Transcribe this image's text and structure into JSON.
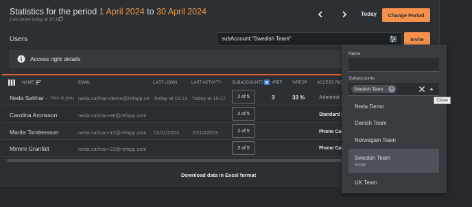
{
  "header": {
    "title_prefix": "Statistics for the period ",
    "start_date": "1 April 2024",
    "title_middle": " to ",
    "end_date": "30 April 2024",
    "calculated": "Calculated today at 15:11",
    "today_label": "Today",
    "change_period_label": "Change Period"
  },
  "users": {
    "label": "Users",
    "search_value": "subAccount:\"Swedish Team\"",
    "invite_label": "Invite"
  },
  "access_details": "Access right details",
  "table": {
    "headers": {
      "name": "NAME",
      "email": "EMAIL",
      "last_login": "LAST LOGIN",
      "last_activity": "LAST ACTIVITY",
      "subaccounts": "SUBACCOUNTS",
      "ref": "#REF",
      "resp": "%RESP",
      "access": "ACCESS RIG"
    },
    "rows": [
      {
        "name": "Neda Sahhar",
        "this_is_you": "← this is you",
        "email": "neda.sahhar+demo@refapp.se",
        "last_login": "Today at 15:13",
        "last_activity": "Today at 15:17",
        "subaccounts": "2 of 5",
        "ref": "3",
        "resp": "33 %",
        "access": "Administ"
      },
      {
        "name": "Carolina Aronsson",
        "email": "neda.sahhar+88@refapp.com",
        "last_login": "",
        "last_activity": "",
        "subaccounts": "2 of 5",
        "ref": "",
        "resp": "",
        "access": "Standard per"
      },
      {
        "name": "Marita Torstensson",
        "email": "neda.sahhar+13@refapp.com",
        "last_login": "03/11/2023",
        "last_activity": "20/10/2023",
        "subaccounts": "2 of 5",
        "ref": "",
        "resp": "",
        "access": "Phone Call H"
      },
      {
        "name": "Mimmi Granfält",
        "email": "neda.sahhar+23@refapp.com",
        "last_login": "",
        "last_activity": "",
        "subaccounts": "2 of 5",
        "ref": "",
        "resp": "",
        "access": "Phone Call H"
      }
    ],
    "download_label": "Download data in Excel format"
  },
  "dropdown": {
    "name_label": "Name",
    "subaccounts_label": "Subaccounts",
    "selected_chip": "Swedish Team",
    "close_tooltip": "Close",
    "options": [
      {
        "label": "Neda Demo",
        "sub": ""
      },
      {
        "label": "Danish Team",
        "sub": ""
      },
      {
        "label": "Norwegian Team",
        "sub": ""
      },
      {
        "label": "Swedish Team",
        "sub": "testar"
      },
      {
        "label": "UK Team",
        "sub": ""
      }
    ]
  },
  "colors": {
    "accent": "#f5914c",
    "background": "#26282c",
    "panel": "#2c2f33"
  },
  "icons": [
    "refresh-icon",
    "chevron-left-icon",
    "chevron-right-icon",
    "filter-sliders-icon",
    "info-icon",
    "columns-icon",
    "sort-icon",
    "excel-icon",
    "close-icon",
    "chevron-up-icon",
    "chip-remove-icon"
  ]
}
